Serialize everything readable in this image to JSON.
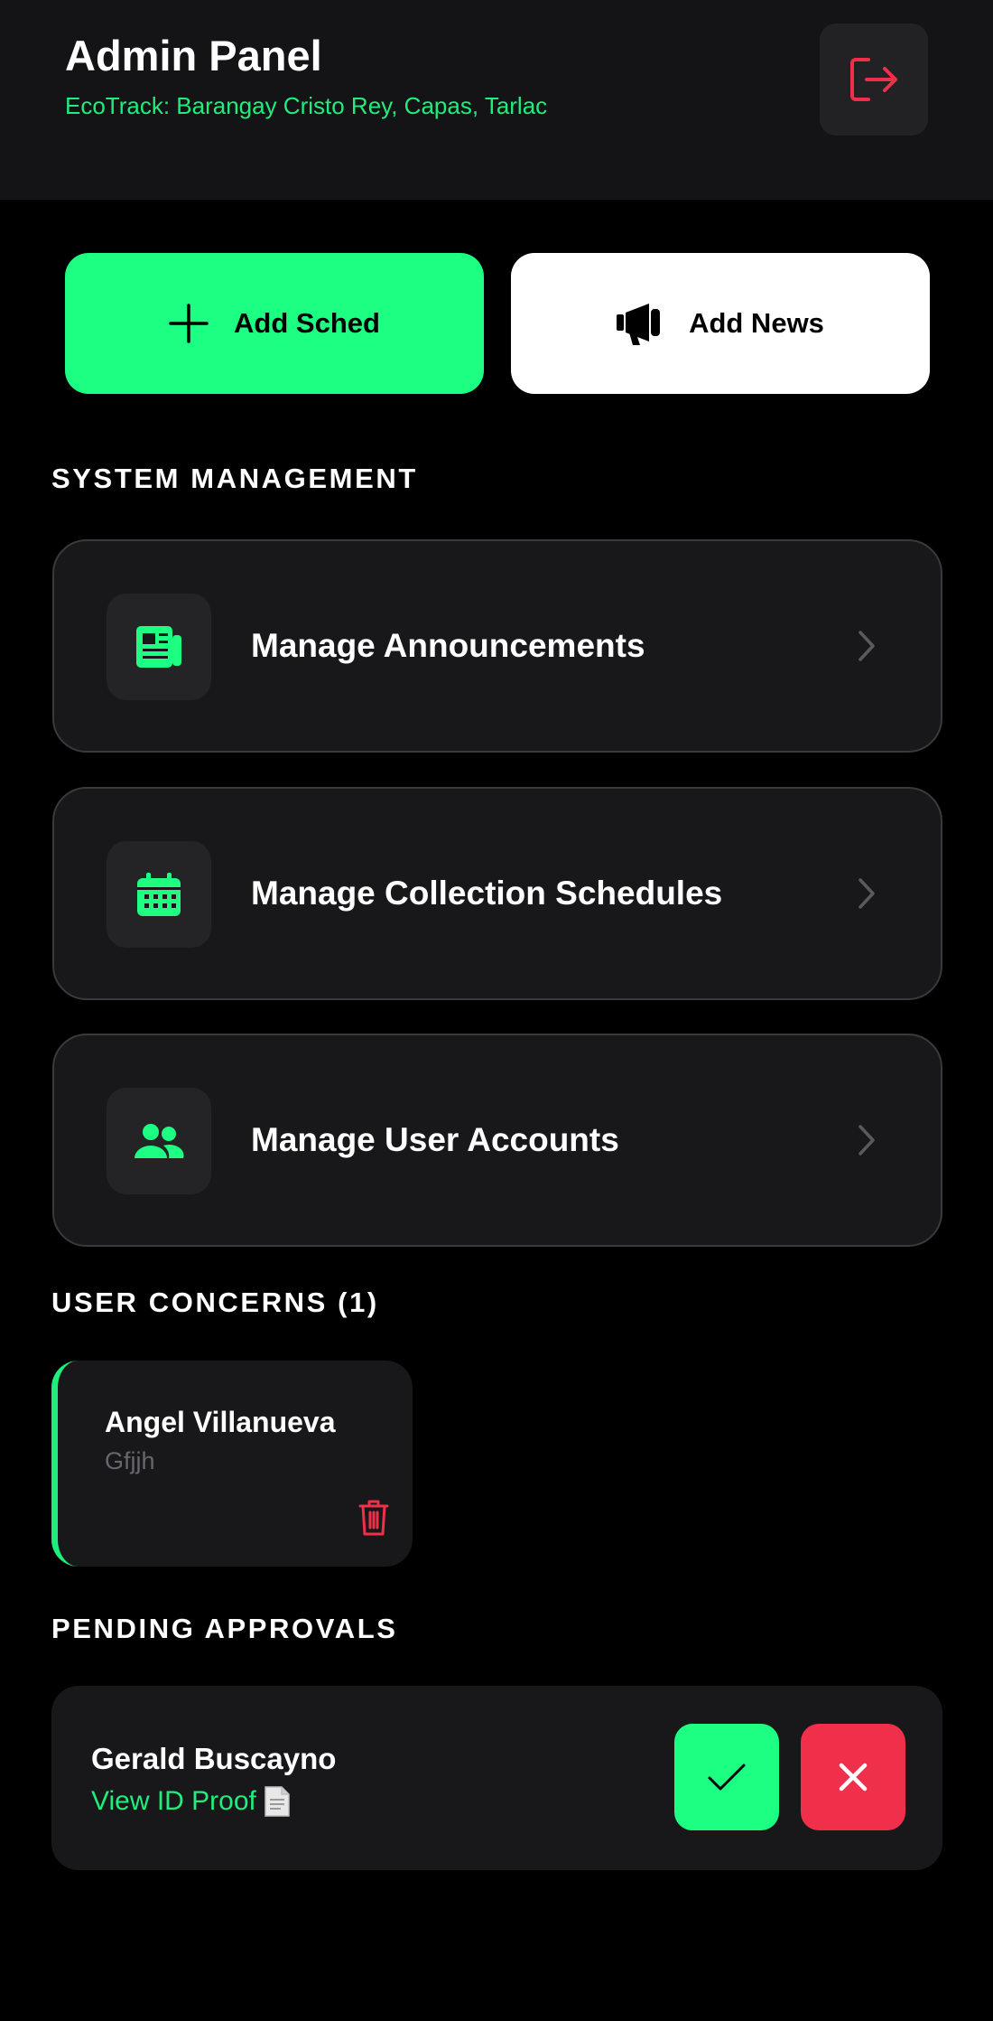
{
  "header": {
    "title": "Admin Panel",
    "subtitle": "EcoTrack: Barangay Cristo Rey, Capas, Tarlac",
    "logout_icon": "logout-icon"
  },
  "actions": {
    "add_sched_label": "Add Sched",
    "add_sched_icon": "plus-icon",
    "add_news_label": "Add News",
    "add_news_icon": "megaphone-icon"
  },
  "system_management": {
    "title": "SYSTEM MANAGEMENT",
    "items": [
      {
        "label": "Manage Announcements",
        "icon": "newspaper-icon"
      },
      {
        "label": "Manage Collection Schedules",
        "icon": "calendar-icon"
      },
      {
        "label": "Manage User Accounts",
        "icon": "users-icon"
      }
    ]
  },
  "user_concerns": {
    "title": "USER CONCERNS (1)",
    "items": [
      {
        "name": "Angel Villanueva",
        "message": "Gfjjh",
        "action_icon": "trash-icon"
      }
    ]
  },
  "pending_approvals": {
    "title": "PENDING APPROVALS",
    "items": [
      {
        "name": "Gerald Buscayno",
        "link_text": "View ID Proof",
        "link_icon": "document-icon",
        "approve_icon": "check-icon",
        "reject_icon": "close-icon"
      }
    ]
  },
  "colors": {
    "accent": "#1cff82",
    "accent_text": "#1fee7d",
    "danger": "#f0304b",
    "background": "#000000",
    "card": "#18181a",
    "header": "#141416"
  }
}
